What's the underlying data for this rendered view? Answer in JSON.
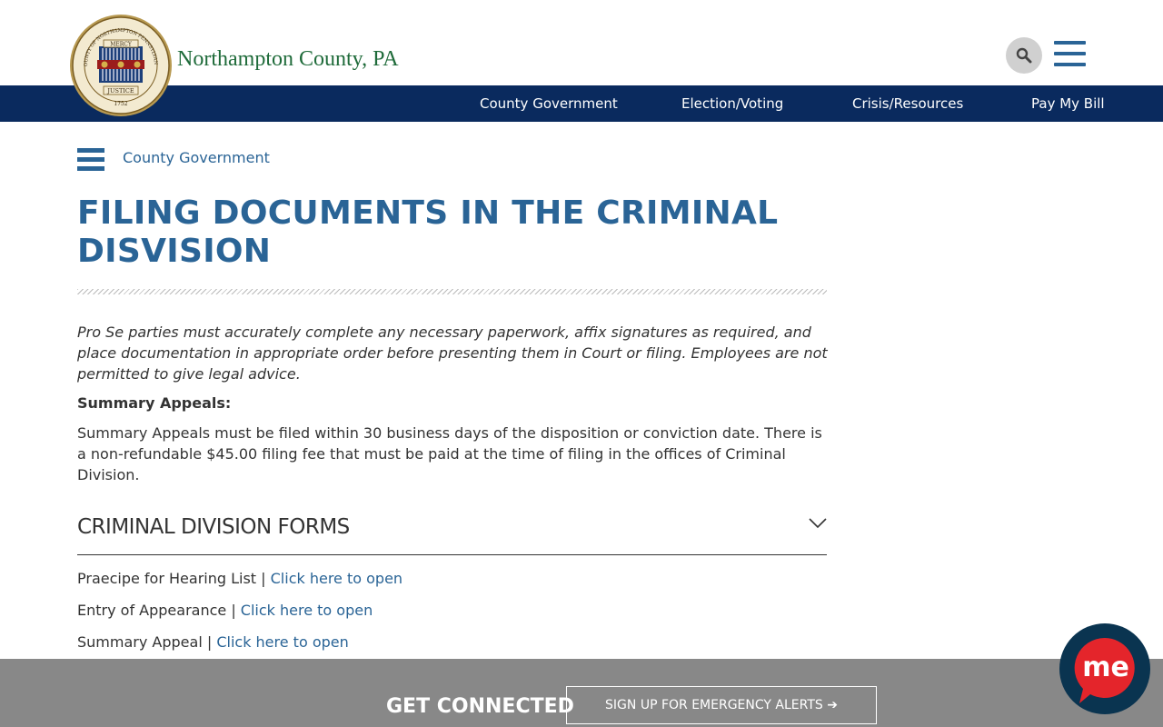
{
  "header": {
    "site_name": "Northampton County, PA",
    "seal_text_top": "COUNTY OF NORTHAMPTON PENNSYLVANIA",
    "seal_mercy": "MERCY",
    "seal_justice": "JUSTICE",
    "seal_year": "1752"
  },
  "nav": {
    "items": [
      "County Government",
      "Election/Voting",
      "Crisis/Resources",
      "Pay My Bill"
    ]
  },
  "breadcrumb": {
    "label": "County Government"
  },
  "page": {
    "title": "FILING DOCUMENTS IN THE CRIMINAL DISVISION",
    "intro": "Pro Se parties must accurately complete any necessary paperwork, affix signatures as required, and place documentation in appropriate order before presenting them in Court or filing. Employees are not permitted to give legal advice.",
    "summary_heading": "Summary Appeals:",
    "summary_text": "Summary Appeals must be filed within 30 business days of the disposition or conviction date. There is a non-refundable $45.00 filing fee that must be paid at the time of filing in the offices of Criminal Division."
  },
  "forms": {
    "title": "CRIMINAL DIVISION FORMS",
    "separator": " | ",
    "items": [
      {
        "name": "Praecipe for Hearing List",
        "link": "Click here to open"
      },
      {
        "name": "Entry of Appearance",
        "link": "Click here to open"
      },
      {
        "name": "Summary Appeal",
        "link": "Click here to open"
      }
    ]
  },
  "footer": {
    "get_connected": "GET CONNECTED",
    "alert_button": "SIGN UP FOR EMERGENCY ALERTS ➔"
  },
  "chat_badge": {
    "label": "me"
  },
  "colors": {
    "nav_bg": "#0a2a5e",
    "accent": "#2a6496",
    "site_name": "#1f6b3a",
    "footer_bg": "#888888",
    "badge_red": "#e4252b"
  }
}
